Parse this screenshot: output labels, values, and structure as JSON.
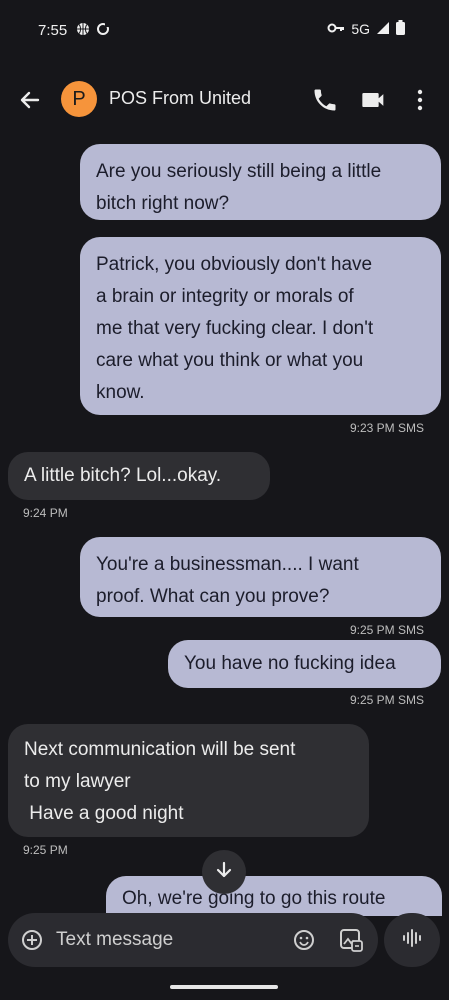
{
  "status": {
    "time": "7:55",
    "network": "5G"
  },
  "header": {
    "avatar_letter": "P",
    "contact_name": "POS From United"
  },
  "messages": {
    "m1": {
      "lines": [
        "Are you seriously still being a little",
        "bitch right now?"
      ]
    },
    "m2": {
      "lines": [
        "Patrick, you obviously don't have",
        "a brain or integrity or morals of",
        "me that very fucking clear. I don't",
        "care what you think or what you",
        "know."
      ],
      "meta": "9:23 PM SMS"
    },
    "m3": {
      "lines": [
        "A little bitch? Lol...okay."
      ],
      "meta": "9:24 PM"
    },
    "m4": {
      "lines": [
        "You're a businessman.... I want",
        "proof. What can you prove?"
      ],
      "meta": "9:25 PM SMS"
    },
    "m5": {
      "lines": [
        "You have no fucking idea"
      ],
      "meta": "9:25 PM SMS"
    },
    "m6": {
      "lines": [
        "Next communication will be sent",
        "to my lawyer",
        " Have a good night"
      ],
      "meta": "9:25 PM"
    },
    "m7": {
      "lines": [
        "Oh, we're going to go this route"
      ]
    }
  },
  "composer": {
    "placeholder": "Text message"
  },
  "icons": [
    "wifi-icon",
    "sync-icon",
    "vpn-key-icon",
    "signal-icon",
    "battery-icon",
    "back-arrow-icon",
    "phone-icon",
    "video-call-icon",
    "more-vert-icon",
    "scroll-down-icon",
    "add-icon",
    "emoji-icon",
    "gallery-icon",
    "voice-icon"
  ]
}
